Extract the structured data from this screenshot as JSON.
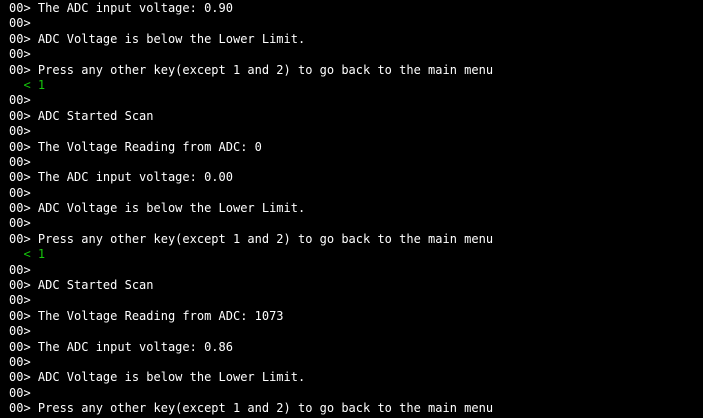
{
  "colors": {
    "background": "#000000",
    "text": "#ffffff",
    "echo": "#16c60c"
  },
  "lines": [
    {
      "kind": "out",
      "text": "00> The ADC input voltage: 0.90"
    },
    {
      "kind": "out",
      "text": "00>"
    },
    {
      "kind": "out",
      "text": "00> ADC Voltage is below the Lower Limit."
    },
    {
      "kind": "out",
      "text": "00>"
    },
    {
      "kind": "out",
      "text": "00> Press any other key(except 1 and 2) to go back to the main menu"
    },
    {
      "kind": "echo",
      "text": "  < 1"
    },
    {
      "kind": "out",
      "text": "00>"
    },
    {
      "kind": "out",
      "text": "00> ADC Started Scan"
    },
    {
      "kind": "out",
      "text": "00>"
    },
    {
      "kind": "out",
      "text": "00> The Voltage Reading from ADC: 0"
    },
    {
      "kind": "out",
      "text": "00>"
    },
    {
      "kind": "out",
      "text": "00> The ADC input voltage: 0.00"
    },
    {
      "kind": "out",
      "text": "00>"
    },
    {
      "kind": "out",
      "text": "00> ADC Voltage is below the Lower Limit."
    },
    {
      "kind": "out",
      "text": "00>"
    },
    {
      "kind": "out",
      "text": "00> Press any other key(except 1 and 2) to go back to the main menu"
    },
    {
      "kind": "echo",
      "text": "  < 1"
    },
    {
      "kind": "out",
      "text": "00>"
    },
    {
      "kind": "out",
      "text": "00> ADC Started Scan"
    },
    {
      "kind": "out",
      "text": "00>"
    },
    {
      "kind": "out",
      "text": "00> The Voltage Reading from ADC: 1073"
    },
    {
      "kind": "out",
      "text": "00>"
    },
    {
      "kind": "out",
      "text": "00> The ADC input voltage: 0.86"
    },
    {
      "kind": "out",
      "text": "00>"
    },
    {
      "kind": "out",
      "text": "00> ADC Voltage is below the Lower Limit."
    },
    {
      "kind": "out",
      "text": "00>"
    },
    {
      "kind": "out",
      "text": "00> Press any other key(except 1 and 2) to go back to the main menu"
    }
  ]
}
